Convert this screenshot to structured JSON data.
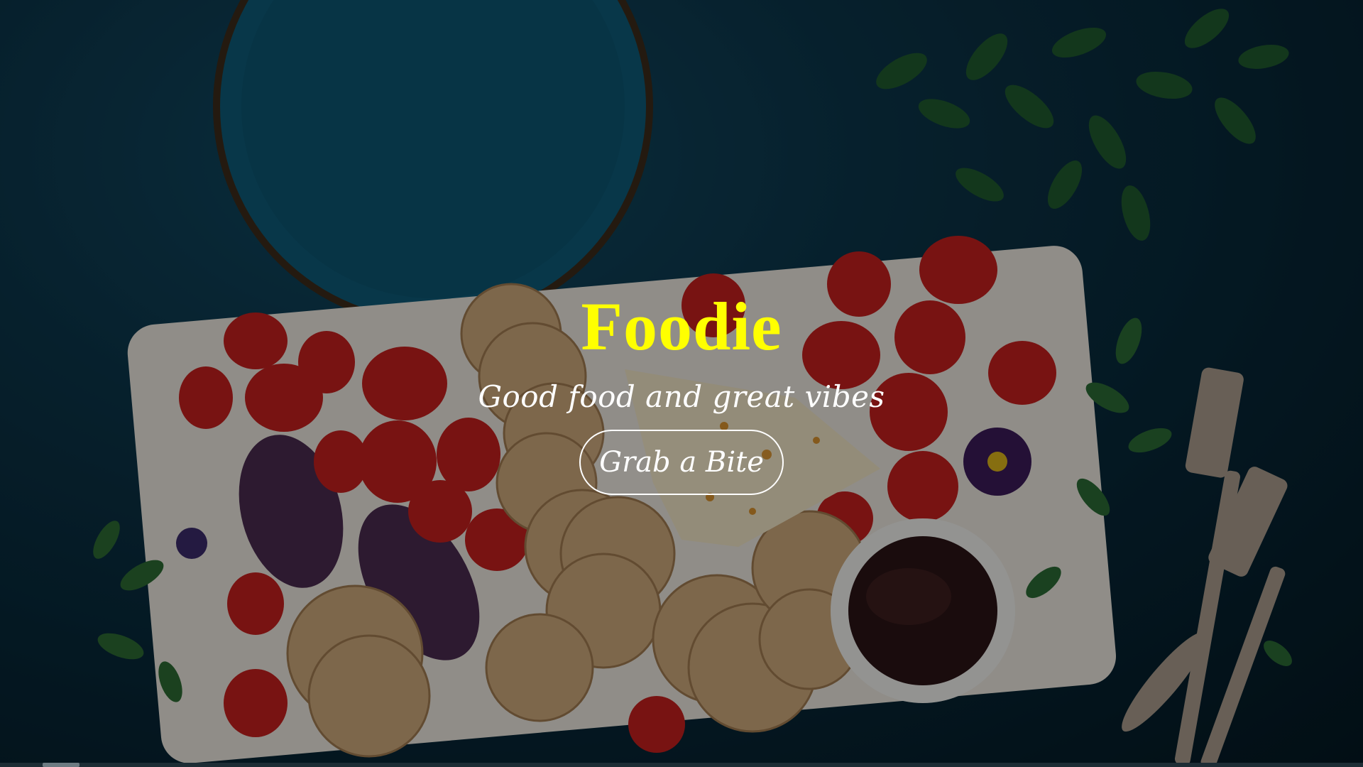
{
  "hero": {
    "title": "Foodie",
    "tagline": "Good food and great vibes",
    "cta_label": "Grab a Bite"
  },
  "colors": {
    "title": "#ffff00",
    "background": "#0b3448",
    "text": "#ffffff"
  },
  "background_image": "charcuterie-board-with-strawberries-crackers-and-jam"
}
